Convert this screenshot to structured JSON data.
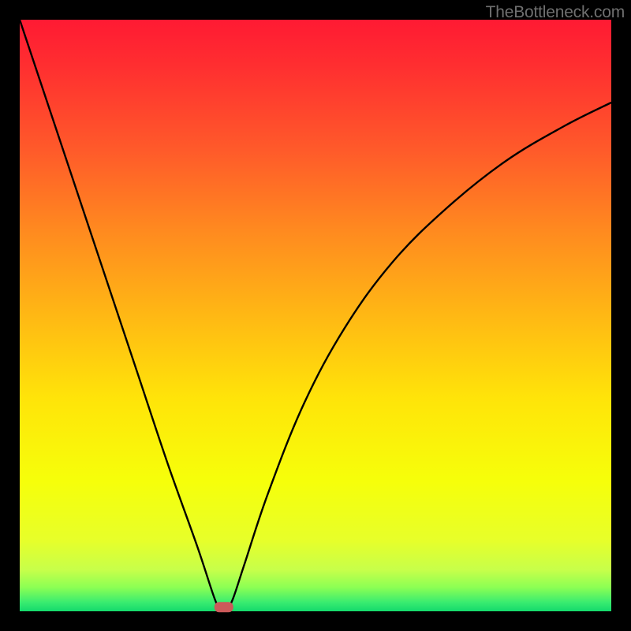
{
  "watermark": "TheBottleneck.com",
  "chart_data": {
    "type": "line",
    "title": "",
    "xlabel": "",
    "ylabel": "",
    "xlim": [
      0,
      100
    ],
    "ylim": [
      0,
      100
    ],
    "grid": false,
    "legend": false,
    "series": [
      {
        "name": "bottleneck-curve",
        "x": [
          0,
          5,
          10,
          15,
          20,
          25,
          30,
          33,
          34,
          35,
          36,
          38,
          42,
          48,
          55,
          63,
          72,
          82,
          92,
          100
        ],
        "values": [
          100,
          85,
          70,
          55,
          40,
          25,
          11,
          2,
          0.5,
          0.5,
          2,
          8,
          20,
          35,
          48,
          59,
          68,
          76,
          82,
          86
        ]
      }
    ],
    "marker": {
      "name": "optimal-point",
      "x": 34.5,
      "y": 0.7,
      "shape": "rounded-rect",
      "color": "#cc5a5a"
    },
    "background_gradient": {
      "top": "#ff1a33",
      "mid_upper": "#ff8b1f",
      "mid": "#ffe409",
      "mid_lower": "#e7ff2a",
      "bottom": "#14d96c"
    }
  }
}
